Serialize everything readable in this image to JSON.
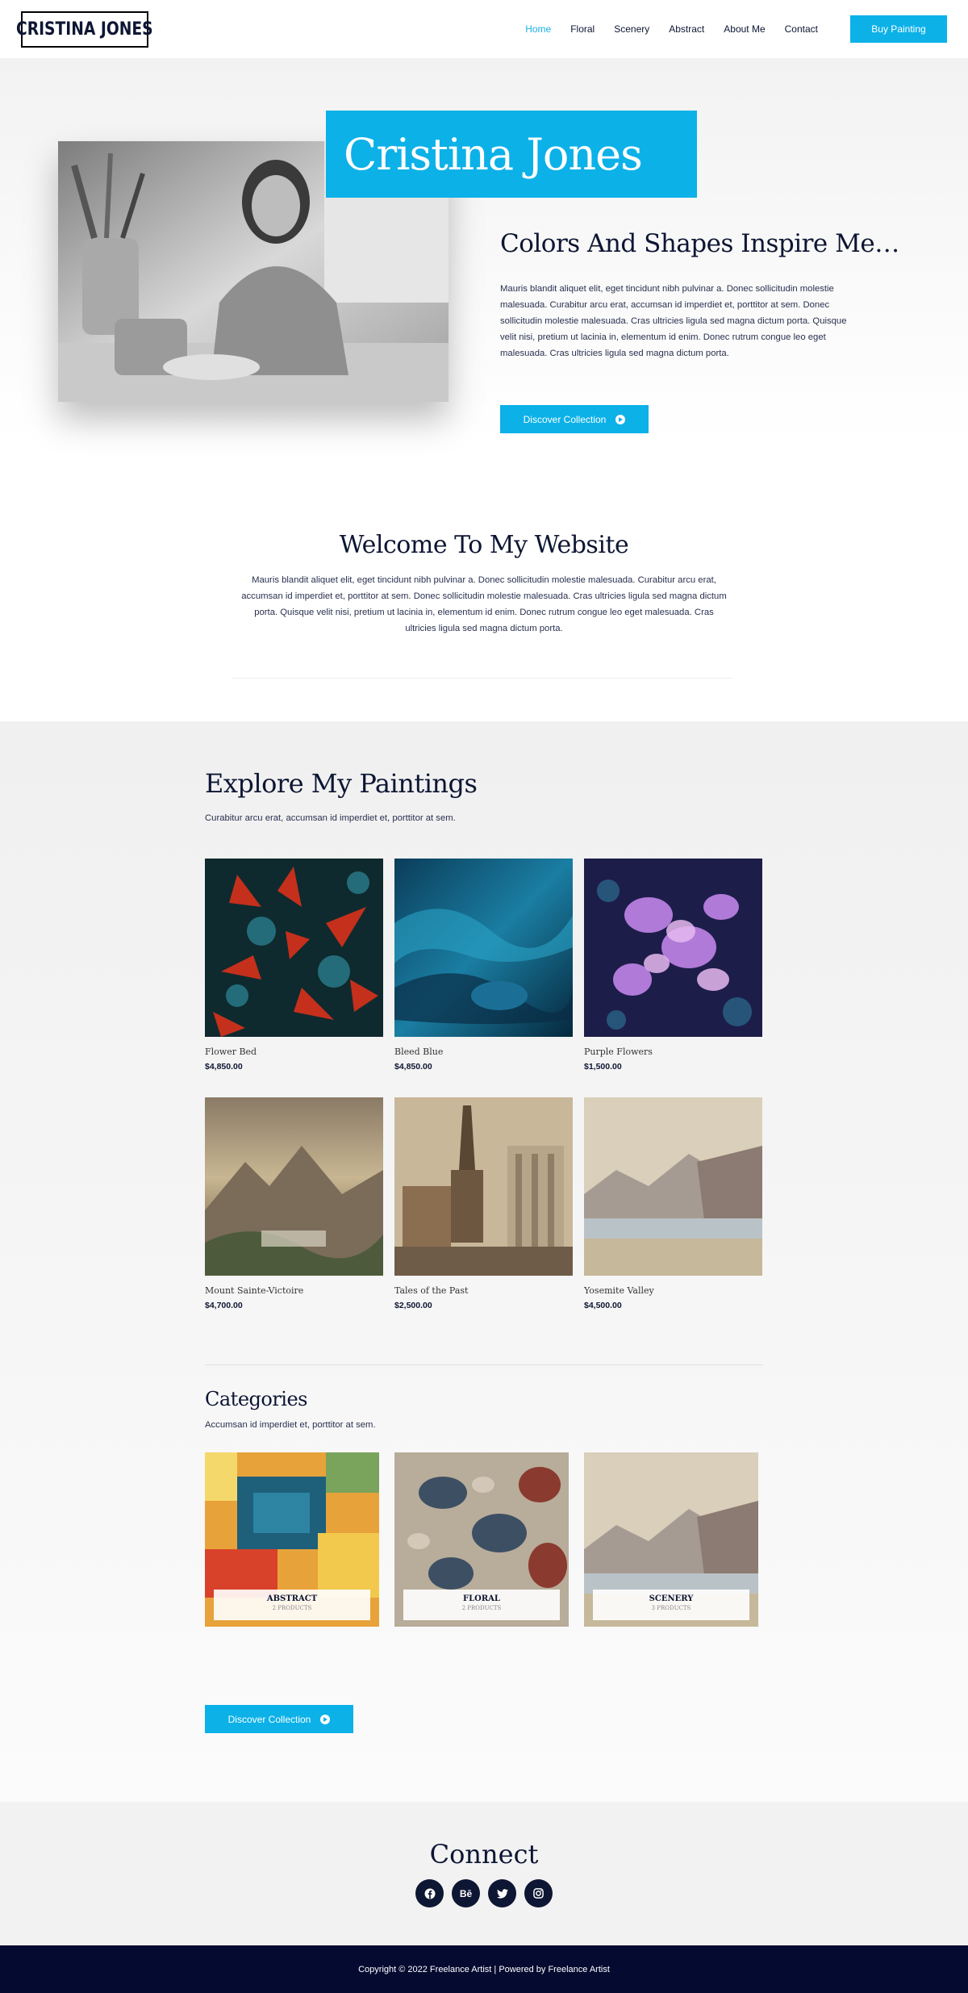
{
  "header": {
    "logo": "CRISTINA JONES",
    "nav": [
      "Home",
      "Floral",
      "Scenery",
      "Abstract",
      "About Me",
      "Contact"
    ],
    "cta": "Buy Painting",
    "colors": {
      "accent": "#0cb1e8",
      "text": "#0d1633"
    }
  },
  "hero": {
    "name": "Cristina Jones",
    "heading": "Colors And Shapes Inspire Me…",
    "paragraph": "Mauris blandit aliquet elit, eget tincidunt nibh pulvinar a. Donec sollicitudin molestie malesuada. Curabitur arcu erat, accumsan id imperdiet et, porttitor at sem. Donec sollicitudin molestie malesuada. Cras ultricies ligula sed magna dictum porta. Quisque velit nisi, pretium ut lacinia in, elementum id enim. Donec rutrum congue leo eget malesuada. Cras ultricies ligula sed magna dictum porta.",
    "button": "Discover Collection"
  },
  "welcome": {
    "title": "Welcome To My Website",
    "paragraph": "Mauris blandit aliquet elit, eget tincidunt nibh pulvinar a. Donec sollicitudin molestie malesuada. Curabitur arcu erat, accumsan id imperdiet et, porttitor at sem. Donec sollicitudin molestie malesuada. Cras ultricies ligula sed magna dictum porta. Quisque velit nisi, pretium ut lacinia in, elementum id enim. Donec rutrum congue leo eget malesuada. Cras ultricies ligula sed magna dictum porta."
  },
  "paintings": {
    "title": "Explore My Paintings",
    "subtitle": "Curabitur arcu erat, accumsan id imperdiet et, porttitor at sem.",
    "items": [
      {
        "name": "Flower Bed",
        "price": "$4,850.00"
      },
      {
        "name": "Bleed Blue",
        "price": "$4,850.00"
      },
      {
        "name": "Purple Flowers",
        "price": "$1,500.00"
      },
      {
        "name": "Mount Sainte-Victoire",
        "price": "$4,700.00"
      },
      {
        "name": "Tales of the Past",
        "price": "$2,500.00"
      },
      {
        "name": "Yosemite Valley",
        "price": "$4,500.00"
      }
    ]
  },
  "categories": {
    "title": "Categories",
    "subtitle": "Accumsan id imperdiet et, porttitor at sem.",
    "items": [
      {
        "name": "ABSTRACT",
        "count": "2 PRODUCTS"
      },
      {
        "name": "FLORAL",
        "count": "2 PRODUCTS"
      },
      {
        "name": "SCENERY",
        "count": "3 PRODUCTS"
      }
    ],
    "button": "Discover Collection"
  },
  "connect": {
    "title": "Connect",
    "socials": [
      "facebook-icon",
      "behance-icon",
      "twitter-icon",
      "instagram-icon"
    ],
    "behance_label": "Bē"
  },
  "footer": {
    "copyright": "Copyright © 2022 Freelance Artist | Powered by Freelance Artist"
  }
}
